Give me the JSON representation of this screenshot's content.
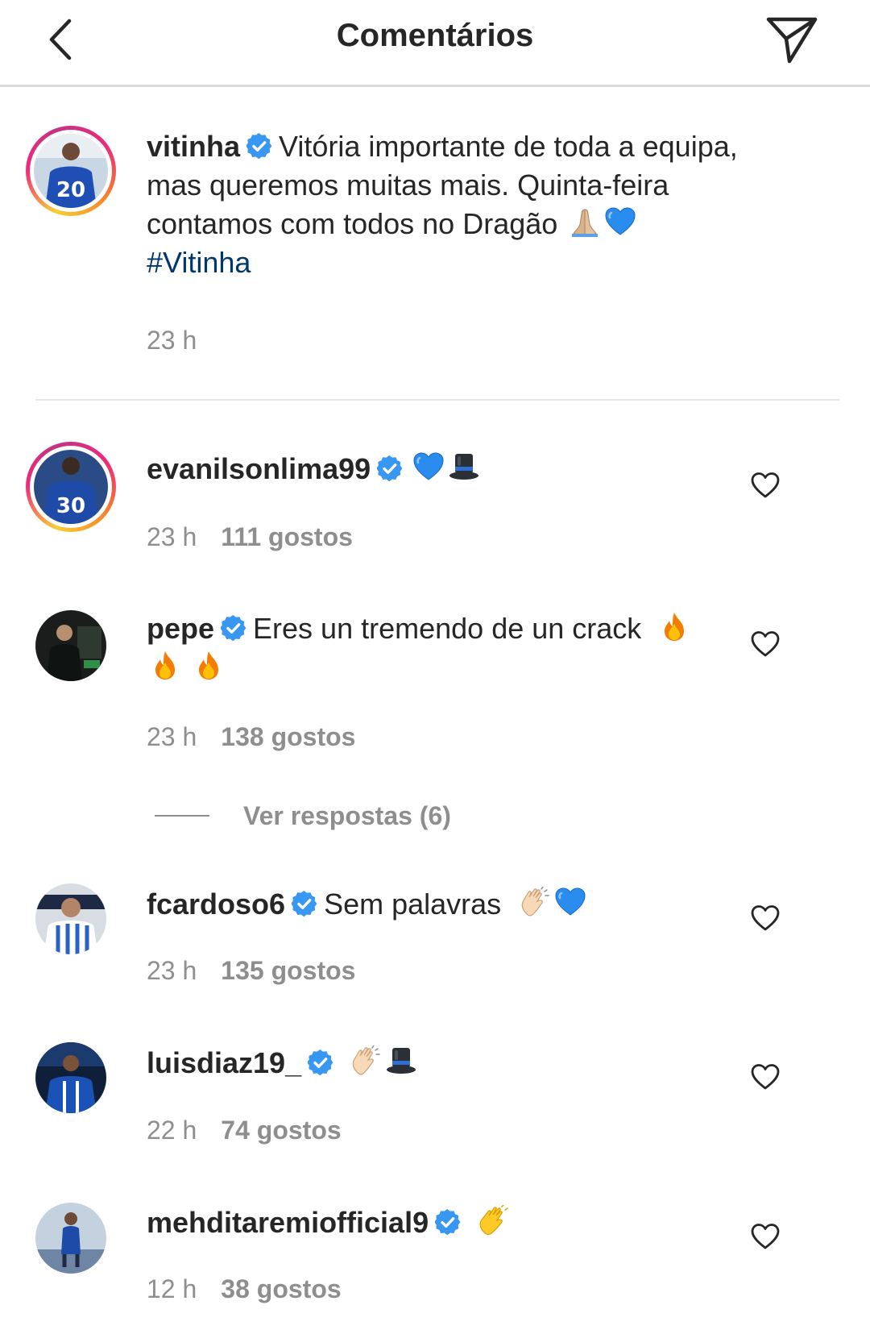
{
  "header": {
    "title": "Comentários"
  },
  "caption": {
    "username": "vitinha",
    "text": "Vitória importante de toda a equipa, mas queremos muitas mais. Quinta-feira contamos com todos no Dragão",
    "emojis": [
      "folded-hands-emoji",
      "blue-heart-emoji"
    ],
    "hashtag": "#Vitinha",
    "time": "23 h",
    "jersey_number": "20"
  },
  "comments": [
    {
      "username": "evanilsonlima99",
      "text": "",
      "emojis": [
        "blue-heart-emoji",
        "top-hat-emoji"
      ],
      "time": "23 h",
      "likes": "111 gostos",
      "jersey_number": "30"
    },
    {
      "username": "pepe",
      "text": "Eres un tremendo de un crack",
      "emojis": [
        "fire-emoji",
        "fire-emoji",
        "fire-emoji"
      ],
      "time": "23 h",
      "likes": "138 gostos",
      "view_replies": "Ver respostas (6)"
    },
    {
      "username": "fcardoso6",
      "text": "Sem palavras",
      "emojis": [
        "clapping-hands-emoji",
        "blue-heart-emoji"
      ],
      "time": "23 h",
      "likes": "135 gostos"
    },
    {
      "username": "luisdiaz19_",
      "text": "",
      "emojis": [
        "clapping-hands-emoji",
        "top-hat-emoji"
      ],
      "time": "22 h",
      "likes": "74 gostos"
    },
    {
      "username": "mehditaremiofficial9",
      "text": "",
      "emojis": [
        "waving-hand-emoji"
      ],
      "time": "12 h",
      "likes": "38 gostos"
    }
  ],
  "colors": {
    "text": "#262626",
    "secondary": "#8e8e8e",
    "hashtag": "#00376b",
    "verified": "#3897f0",
    "divider": "#dbdbdb"
  }
}
